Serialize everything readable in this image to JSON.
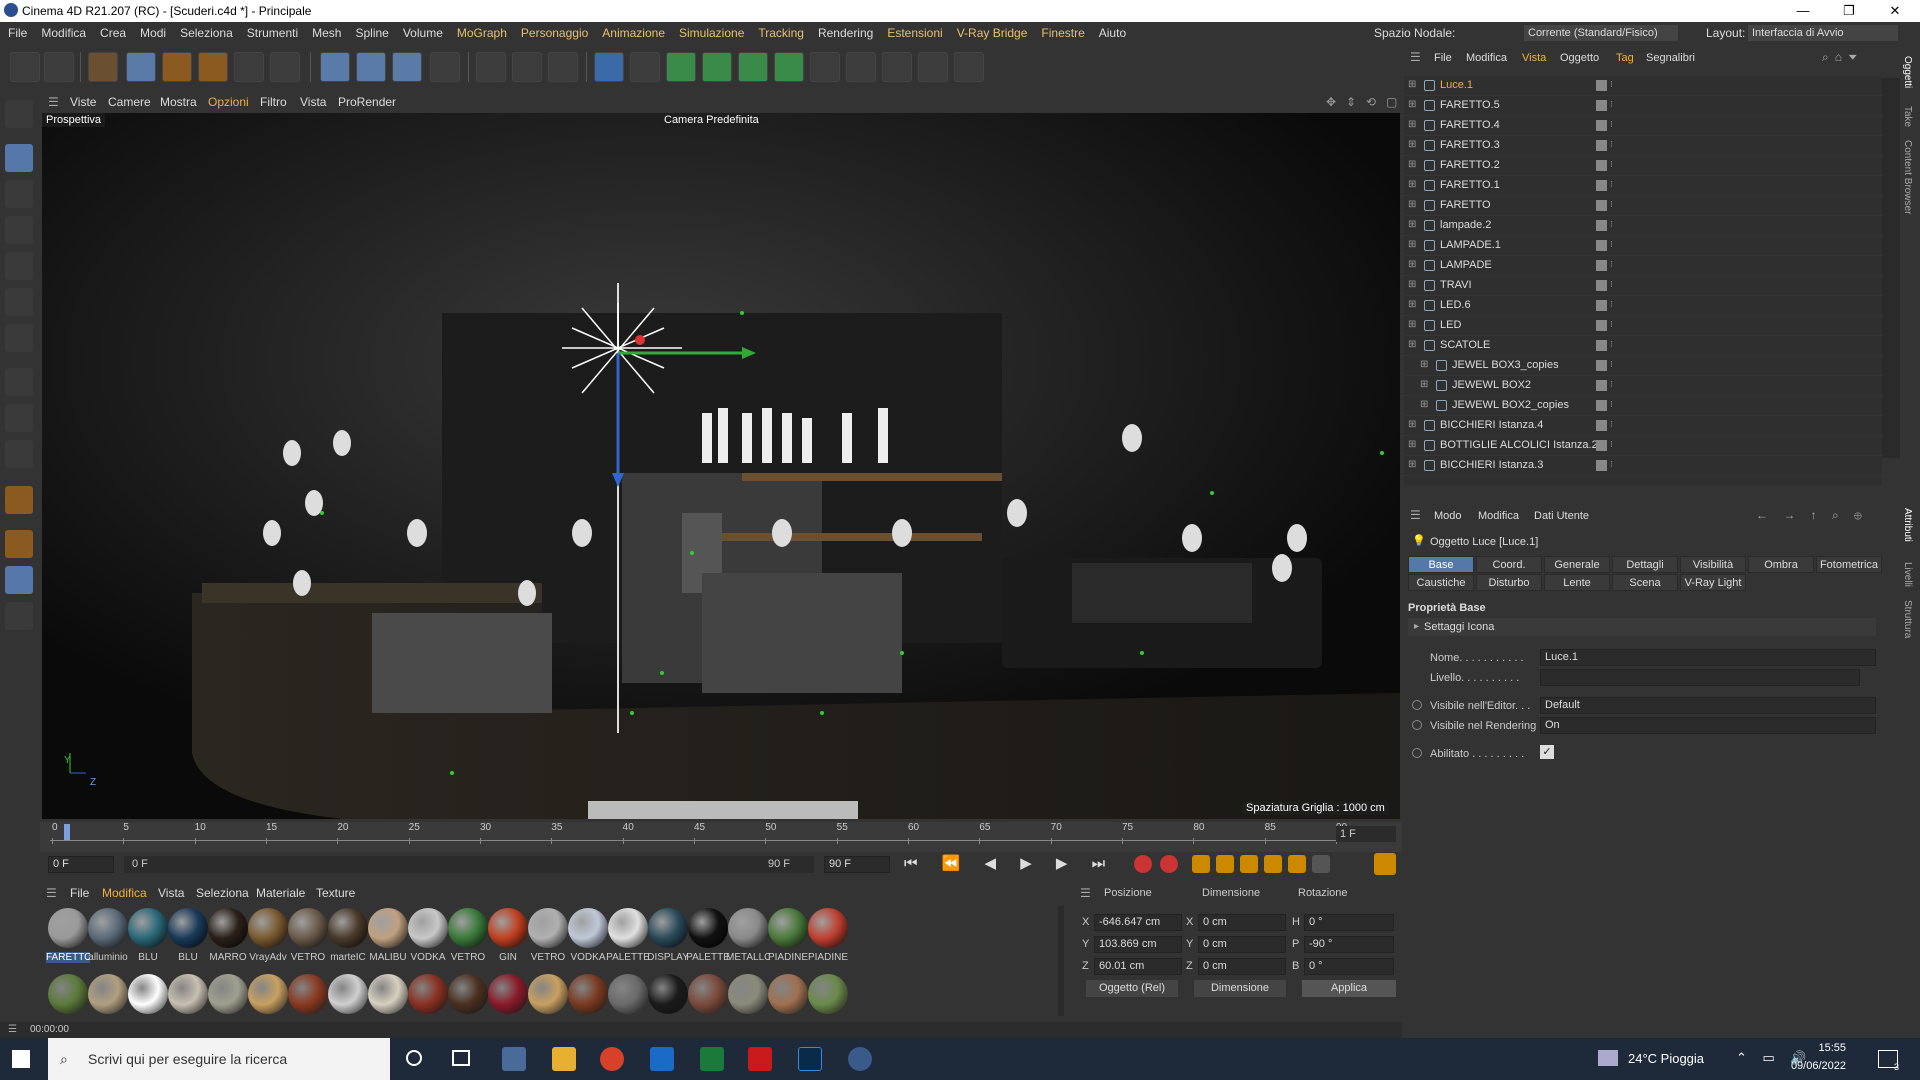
{
  "title_bar": {
    "title": "Cinema 4D R21.207 (RC) - [Scuderi.c4d *] - Principale",
    "minimize": "—",
    "maximize": "❐",
    "close": "✕"
  },
  "menu": [
    "File",
    "Modifica",
    "Crea",
    "Modi",
    "Seleziona",
    "Strumenti",
    "Mesh",
    "Spline",
    "Volume",
    "MoGraph",
    "Personaggio",
    "Animazione",
    "Simulazione",
    "Tracking",
    "Rendering",
    "Estensioni",
    "V-Ray Bridge",
    "Finestre",
    "Aiuto"
  ],
  "node_space": {
    "label": "Spazio Nodale:",
    "value": "Corrente (Standard/Fisico)"
  },
  "layout": {
    "label": "Layout:",
    "value": "Interfaccia di Avvio"
  },
  "viewport_menu": [
    "Viste",
    "Camere",
    "Mostra",
    "Opzioni",
    "Filtro",
    "Vista",
    "ProRender"
  ],
  "viewport": {
    "view_name": "Prospettiva",
    "camera": "Camera Predefinita",
    "grid": "Spaziatura Griglia : 1000 cm",
    "axis_y": "Y",
    "axis_z": "Z"
  },
  "timeline": {
    "ticks": [
      "0",
      "5",
      "10",
      "15",
      "20",
      "25",
      "30",
      "35",
      "40",
      "45",
      "50",
      "55",
      "60",
      "65",
      "70",
      "75",
      "80",
      "85",
      "90"
    ],
    "current_frame": "1 F",
    "start": "0 F",
    "range_start": "0 F",
    "range_end": "90 F",
    "end": "90 F"
  },
  "status": {
    "time": "00:00:00"
  },
  "mat_menu": [
    "File",
    "Modifica",
    "Vista",
    "Seleziona",
    "Materiale",
    "Texture"
  ],
  "materials_row1": [
    {
      "name": "FARETTO",
      "color": "#9a9a9a"
    },
    {
      "name": "alluminio",
      "color": "#5a6a78"
    },
    {
      "name": "BLU",
      "color": "#2a6878"
    },
    {
      "name": "BLU",
      "color": "#1a3a5a"
    },
    {
      "name": "MARRO",
      "color": "#2a2018"
    },
    {
      "name": "VrayAdv",
      "color": "#7a5a30"
    },
    {
      "name": "VETRO",
      "color": "#6a5a4a"
    },
    {
      "name": "marteIC",
      "color": "#4a3a2a"
    },
    {
      "name": "MALIBU",
      "color": "#c0a080"
    },
    {
      "name": "VODKA",
      "color": "#c8c8c8"
    },
    {
      "name": "VETRO",
      "color": "#3a7a3a"
    },
    {
      "name": "GIN",
      "color": "#c04020"
    },
    {
      "name": "VETRO",
      "color": "#b0b0b0"
    },
    {
      "name": "VODKA",
      "color": "#c0c8d8"
    },
    {
      "name": "PALETTE",
      "color": "#e0e0e0"
    },
    {
      "name": "DISPLAY",
      "color": "#2a4a5a"
    },
    {
      "name": "PALETTE",
      "color": "#111111"
    },
    {
      "name": "METALLO",
      "color": "#8a8a8a"
    },
    {
      "name": "PIADINE",
      "color": "#4a7a3a"
    },
    {
      "name": "PIADINE",
      "color": "#c04030"
    }
  ],
  "materials_row2": [
    "#5a7a3a",
    "#b0a080",
    "#ffffff",
    "#c8c0b0",
    "#a0a090",
    "#c8a060",
    "#8a3a20",
    "#d0d0d0",
    "#d8d0c0",
    "#8a3020",
    "#4a3020",
    "#8a1a2a",
    "#c8a060",
    "#7a3a20",
    "#6a6a6a",
    "#1a1a1a",
    "#7a4a3a",
    "#8a8a7a",
    "#a07050",
    "#6a8a4a"
  ],
  "coords": {
    "headers": [
      "Posizione",
      "Dimensione",
      "Rotazione"
    ],
    "rows": [
      {
        "a": "X",
        "pos": "-646.647 cm",
        "b": "X",
        "dim": "0 cm",
        "c": "H",
        "rot": "0 °"
      },
      {
        "a": "Y",
        "pos": "103.869 cm",
        "b": "Y",
        "dim": "0 cm",
        "c": "P",
        "rot": "-90 °"
      },
      {
        "a": "Z",
        "pos": "60.01 cm",
        "b": "Z",
        "dim": "0 cm",
        "c": "B",
        "rot": "0 °"
      }
    ],
    "mode": "Oggetto (Rel)",
    "size_mode": "Dimensione",
    "apply": "Applica"
  },
  "obj_menu": [
    "File",
    "Modifica",
    "Vista",
    "Oggetto",
    "Tag",
    "Segnalibri"
  ],
  "objects": [
    {
      "name": "Luce.1",
      "sel": true
    },
    {
      "name": "FARETTO.5"
    },
    {
      "name": "FARETTO.4"
    },
    {
      "name": "FARETTO.3"
    },
    {
      "name": "FARETTO.2"
    },
    {
      "name": "FARETTO.1"
    },
    {
      "name": "FARETTO"
    },
    {
      "name": "lampade.2"
    },
    {
      "name": "LAMPADE.1"
    },
    {
      "name": "LAMPADE"
    },
    {
      "name": "TRAVI"
    },
    {
      "name": "LED.6"
    },
    {
      "name": "LED"
    },
    {
      "name": "SCATOLE"
    },
    {
      "name": "JEWEL BOX3_copies",
      "indent": 1
    },
    {
      "name": "JEWEWL BOX2",
      "indent": 1
    },
    {
      "name": "JEWEWL BOX2_copies",
      "indent": 1
    },
    {
      "name": "BICCHIERI Istanza.4"
    },
    {
      "name": "BOTTIGLIE ALCOLICI Istanza.2"
    },
    {
      "name": "BICCHIERI Istanza.3"
    }
  ],
  "attr_menu": [
    "Modo",
    "Modifica",
    "Dati Utente"
  ],
  "attr": {
    "object_title": "Oggetto Luce [Luce.1]",
    "tabs_row1": [
      "Base",
      "Coord.",
      "Generale",
      "Dettagli",
      "Visibilità",
      "Ombra",
      "Fotometrica"
    ],
    "tabs_row2": [
      "Caustiche",
      "Disturbo",
      "Lente",
      "Scena",
      "V-Ray Light"
    ],
    "section": "Proprietà Base",
    "sub": "Settaggi Icona",
    "name_label": "Nome. . . . . . . . . . .",
    "name_value": "Luce.1",
    "layer_label": "Livello. . . . . . . . . .",
    "vis_editor_label": "Visibile nell'Editor. . .",
    "vis_editor_value": "Default",
    "vis_render_label": "Visibile nel Rendering",
    "vis_render_value": "On",
    "enabled_label": "Abilitato . . . . . . . . .",
    "enabled_check": "✓"
  },
  "side_tabs": [
    "Oggetti",
    "Take",
    "Content Browser",
    "Attributi",
    "Livelli",
    "Struttura"
  ],
  "taskbar": {
    "search": "Scrivi qui per eseguire la ricerca",
    "weather": "24°C Pioggia",
    "time": "15:55",
    "date": "09/06/2022",
    "notif": "3"
  }
}
